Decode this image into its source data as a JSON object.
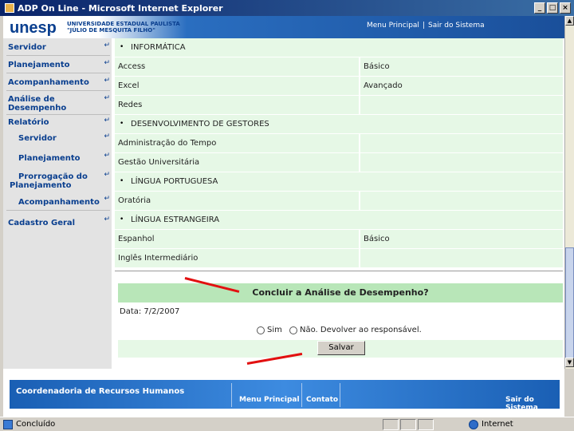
{
  "window": {
    "title": "ADP On Line - Microsoft Internet Explorer",
    "buttons": [
      "_",
      "□",
      "×"
    ]
  },
  "header": {
    "logo": "unesp",
    "university_line1": "UNIVERSIDADE ESTADUAL PAULISTA",
    "university_line2": "\"JÚLIO DE MESQUITA FILHO\"",
    "menu_link": "Menu Principal",
    "separator": "|",
    "exit_link": "Sair do Sistema"
  },
  "sidebar": {
    "servidor": "Servidor",
    "planejamento": "Planejamento",
    "acompanhamento": "Acompanhamento",
    "analise_1": "Análise de",
    "analise_2": "Desempenho",
    "relatorio": "Relatório",
    "sub_servidor": "Servidor",
    "sub_planejamento": "Planejamento",
    "sub_prorrogacao_1": "Prorrogação do",
    "sub_prorrogacao_2": "Planejamento",
    "sub_acompanhamento": "Acompanhamento",
    "cadastro": "Cadastro Geral",
    "arrow": "↵"
  },
  "form": {
    "cat_informatica": "INFORMÁTICA",
    "access": "Access",
    "access_level": "Básico",
    "excel": "Excel",
    "excel_level": "Avançado",
    "redes": "Redes",
    "cat_gestores": "DESENVOLVIMENTO DE GESTORES",
    "adm_tempo": "Administração do Tempo",
    "gestao": "Gestão Universitária",
    "cat_portugues": "LÍNGUA PORTUGUESA",
    "oratoria": "Oratória",
    "cat_estrangeira": "LÍNGUA ESTRANGEIRA",
    "espanhol": "Espanhol",
    "espanhol_level": "Básico",
    "ingles": "Inglês Intermediário",
    "bullet": "•"
  },
  "conclude": {
    "question": "Concluir a Análise de Desempenho?",
    "date": "Data: 7/2/2007",
    "option_yes": "Sim",
    "option_no": "Não. Devolver ao responsável.",
    "save_button": "Salvar"
  },
  "footer": {
    "title": "Coordenadoria de Recursos Humanos",
    "menu": "Menu Principal",
    "contato": "Contato",
    "sair": "Sair do Sistema"
  },
  "status": {
    "text": "Concluído",
    "zone": "Internet"
  },
  "colors": {
    "accent": "#0a3f8f",
    "row_bg": "#e6f8e6",
    "highlight_bg": "#b8e6b8",
    "annotation": "#e21010"
  }
}
